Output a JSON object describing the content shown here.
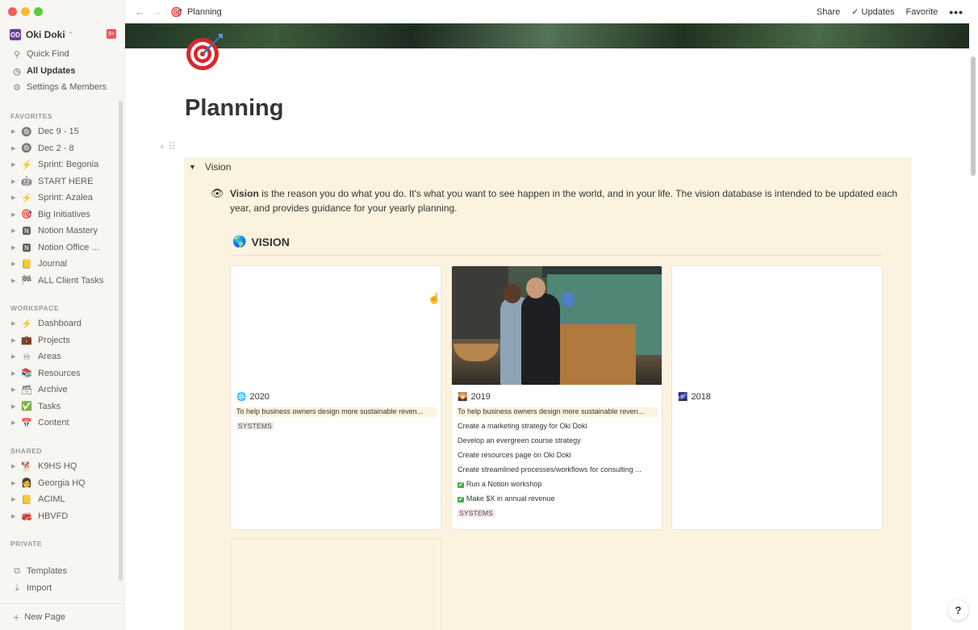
{
  "window": {
    "title": "Planning"
  },
  "sidebar": {
    "workspace": {
      "name": "Oki Doki",
      "icon_text": "OD",
      "badge": "9+"
    },
    "top_links": [
      {
        "label": "Quick Find",
        "icon": "search-icon"
      },
      {
        "label": "All Updates",
        "icon": "clock-icon"
      },
      {
        "label": "Settings & Members",
        "icon": "gear-icon"
      }
    ],
    "favorites_heading": "FAVORITES",
    "favorites": [
      {
        "emoji": "🔘",
        "label": "Dec 9 - 15"
      },
      {
        "emoji": "🔘",
        "label": "Dec 2 - 8"
      },
      {
        "emoji": "⚡",
        "label": "Sprint: Begonia"
      },
      {
        "emoji": "🤖",
        "label": "START HERE"
      },
      {
        "emoji": "⚡",
        "label": "Sprint: Azalea"
      },
      {
        "emoji": "🎯",
        "label": "Big Initiatives"
      },
      {
        "emoji": "🅽",
        "label": "Notion Mastery"
      },
      {
        "emoji": "🅽",
        "label": "Notion Office ..."
      },
      {
        "emoji": "📒",
        "label": "Journal"
      },
      {
        "emoji": "🏁",
        "label": "ALL Client Tasks"
      }
    ],
    "workspace_heading": "WORKSPACE",
    "workspace_pages": [
      {
        "emoji": "⚡",
        "label": "Dashboard"
      },
      {
        "emoji": "💼",
        "label": "Projects"
      },
      {
        "emoji": "♾",
        "label": "Areas"
      },
      {
        "emoji": "📚",
        "label": "Resources"
      },
      {
        "emoji": "🗃",
        "label": "Archive"
      },
      {
        "emoji": "✅",
        "label": "Tasks"
      },
      {
        "emoji": "📅",
        "label": "Content"
      }
    ],
    "shared_heading": "SHARED",
    "shared_pages": [
      {
        "emoji": "🐕",
        "label": "K9HS HQ"
      },
      {
        "emoji": "👩",
        "label": "Georgia HQ"
      },
      {
        "emoji": "📒",
        "label": "ACIML"
      },
      {
        "emoji": "🚒",
        "label": "HBVFD"
      }
    ],
    "private_heading": "PRIVATE",
    "bottom_links": [
      {
        "label": "Templates",
        "icon": "templates-icon"
      },
      {
        "label": "Import",
        "icon": "import-icon"
      }
    ],
    "new_page": "New Page"
  },
  "topbar": {
    "breadcrumb_emoji": "🎯",
    "breadcrumb": "Planning",
    "share": "Share",
    "updates": "Updates",
    "favorite": "Favorite",
    "more": "•••"
  },
  "page": {
    "icon": "target-icon",
    "title": "Planning",
    "toggle_label": "Vision",
    "callout": {
      "bold": "Vision",
      "rest": " is the reason you do what you do. It's what you want to see happen in the world, and in your life. The vision database is intended to be updated each year, and provides guidance for your yearly planning."
    },
    "database": {
      "emoji": "🌎",
      "title": "VISION",
      "cards": [
        {
          "emoji": "🌐",
          "title": "2020",
          "highlight": "To help business owners design more sustainable reven...",
          "items": [],
          "tag": "SYSTEMS"
        },
        {
          "emoji": "🌄",
          "title": "2019",
          "highlight": "To help business owners design more sustainable reven...",
          "items": [
            {
              "text": "Create a marketing strategy for Oki Doki",
              "checked": false
            },
            {
              "text": "Develop an evergreen course strategy",
              "checked": false
            },
            {
              "text": "Create resources page on Oki Doki",
              "checked": false
            },
            {
              "text": "Create streamlined processes/workflows for consulting ...",
              "checked": false
            },
            {
              "text": "Run a Notion workshop",
              "checked": true
            },
            {
              "text": "Make $X in annual revenue",
              "checked": true
            }
          ],
          "tag": "SYSTEMS"
        },
        {
          "emoji": "🌌",
          "title": "2018",
          "highlight": "",
          "items": [],
          "tag": ""
        }
      ]
    }
  },
  "help": "?",
  "colors": {
    "callout_bg": "#fbf3e0",
    "sidebar_bg": "#f7f6f3",
    "tag_bg": "#f1e7e7",
    "check_green": "#4caa45"
  }
}
